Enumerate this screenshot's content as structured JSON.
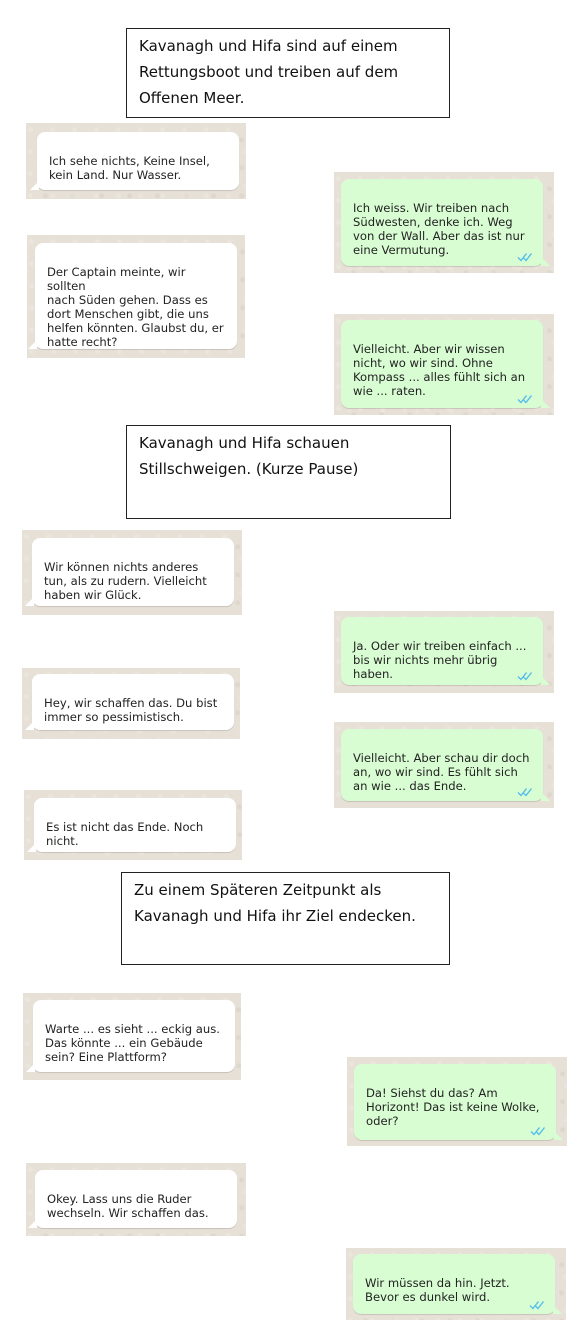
{
  "colors": {
    "incoming_bubble": "#ffffff",
    "outgoing_bubble": "#d9fdd3",
    "read_ticks": "#53bdeb",
    "chat_background": "#e6e0d6"
  },
  "narrations": [
    "Kavanagh und Hifa sind auf einem\nRettungsboot und treiben auf dem\nOffenen Meer.",
    "Kavanagh und Hifa schauen\nStillschweigen. (Kurze Pause)",
    "Zu einem Späteren Zeitpunkt als\nKavanagh und Hifa ihr Ziel endecken."
  ],
  "messages": [
    {
      "direction": "incoming",
      "text": "Ich sehe nichts, Keine Insel,\nkein Land. Nur Wasser."
    },
    {
      "direction": "outgoing",
      "text": "Ich weiss. Wir treiben nach\nSüdwesten, denke ich. Weg\nvon der Wall. Aber das ist nur\neine Vermutung.",
      "status_icon": "double-check-read-icon"
    },
    {
      "direction": "incoming",
      "text": "Der Captain meinte, wir sollten\nnach Süden gehen. Dass es\ndort Menschen gibt, die uns\nhelfen könnten. Glaubst du, er\nhatte recht?"
    },
    {
      "direction": "outgoing",
      "text": "Vielleicht. Aber wir wissen\nnicht, wo wir sind. Ohne\nKompass ... alles fühlt sich an\nwie ... raten.",
      "status_icon": "double-check-read-icon"
    },
    {
      "direction": "incoming",
      "text": "Wir können nichts anderes\ntun, als zu rudern. Vielleicht\nhaben wir Glück."
    },
    {
      "direction": "outgoing",
      "text": "Ja. Oder wir treiben einfach ...\nbis wir nichts mehr übrig\nhaben.",
      "status_icon": "double-check-read-icon"
    },
    {
      "direction": "incoming",
      "text": "Hey, wir schaffen das. Du bist\nimmer so pessimistisch."
    },
    {
      "direction": "outgoing",
      "text": "Vielleicht. Aber schau dir doch\nan, wo wir sind. Es fühlt sich\nan wie ... das Ende.",
      "status_icon": "double-check-read-icon"
    },
    {
      "direction": "incoming",
      "text": "Es ist nicht das Ende. Noch\nnicht."
    },
    {
      "direction": "incoming",
      "text": "Warte ... es sieht ... eckig aus.\nDas könnte ... ein Gebäude\nsein? Eine Plattform?"
    },
    {
      "direction": "outgoing",
      "text": "Da! Siehst du das? Am\nHorizont! Das ist keine Wolke,\noder?",
      "status_icon": "double-check-read-icon"
    },
    {
      "direction": "incoming",
      "text": "Okey. Lass uns die Ruder\nwechseln. Wir schaffen das."
    },
    {
      "direction": "outgoing",
      "text": "Wir müssen da hin. Jetzt.\nBevor es dunkel wird.",
      "status_icon": "double-check-read-icon"
    }
  ]
}
